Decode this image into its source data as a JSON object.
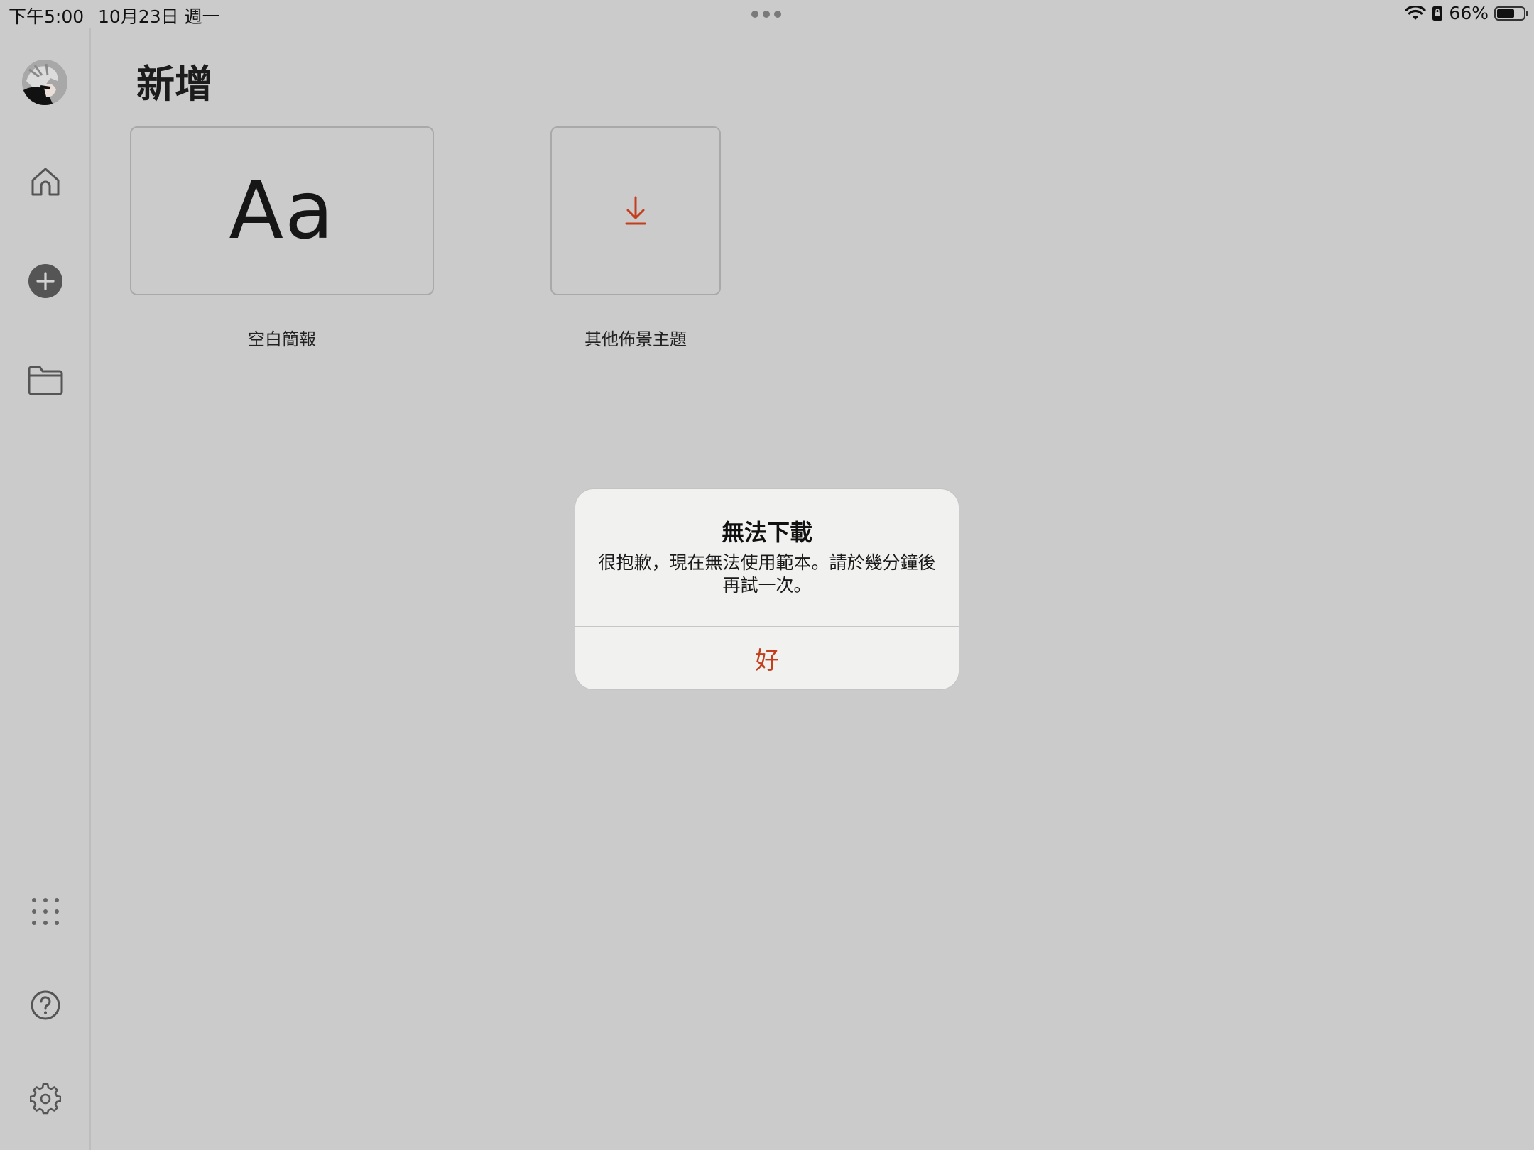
{
  "status_bar": {
    "time": "下午5:00",
    "date": "10月23日 週一",
    "battery_percent": "66%",
    "battery_level": 0.66
  },
  "sidebar": {
    "items": [
      {
        "icon": "home-icon"
      },
      {
        "icon": "plus-circle-icon"
      },
      {
        "icon": "folder-icon"
      },
      {
        "icon": "apps-grid-icon"
      },
      {
        "icon": "help-icon"
      },
      {
        "icon": "settings-gear-icon"
      }
    ]
  },
  "main": {
    "title": "新增",
    "templates": [
      {
        "glyph": "Aa",
        "label": "空白簡報"
      },
      {
        "icon": "download-icon",
        "label": "其他佈景主題"
      }
    ]
  },
  "alert": {
    "title": "無法下載",
    "message": "很抱歉，現在無法使用範本。請於幾分鐘後再試一次。",
    "button_label": "好"
  },
  "colors": {
    "accent": "#c43e1c",
    "background": "#cbcbcb",
    "alert_background": "#f1f1f0"
  }
}
